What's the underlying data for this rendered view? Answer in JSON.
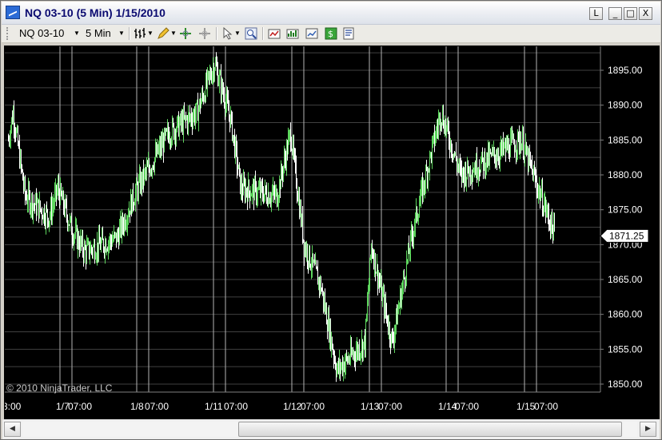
{
  "window": {
    "title": "NQ 03-10 (5 Min)  1/15/2010",
    "buttons": [
      "L",
      "_",
      "□",
      "X"
    ]
  },
  "toolbar": {
    "instrument": "NQ 03-10",
    "interval": "5 Min",
    "icons": [
      "bar-type-icon",
      "drawing-tool-icon",
      "crosshair-icon",
      "global-crosshair-icon",
      "pointer-icon",
      "zoom-icon",
      "data-series-icon",
      "indicators-icon",
      "strategies-icon",
      "money-icon",
      "properties-icon"
    ]
  },
  "chart": {
    "copyright": "© 2010 NinjaTrader, LLC",
    "price_scale": [
      "1895.00",
      "1890.00",
      "1885.00",
      "1880.00",
      "1875.00",
      "1870.00",
      "1865.00",
      "1860.00",
      "1855.00",
      "1850.00"
    ],
    "last_price": "1871.25",
    "time_labels": [
      "3:00",
      "1/7",
      "07:00",
      "1/8",
      "07:00",
      "1/11",
      "07:00",
      "1/12",
      "07:00",
      "1/13",
      "07:00",
      "1/14",
      "07:00",
      "1/15",
      "07:00"
    ],
    "colors": {
      "background": "#000000",
      "up": "#5ed65e",
      "down": "#ffffff",
      "grid": "#404040",
      "separator": "#b4b4b4"
    }
  },
  "chart_data": {
    "type": "line",
    "instrument": "NQ 03-10",
    "interval": "5 Min",
    "ylim": [
      1849,
      1899
    ],
    "x": [
      "1/6 close",
      "1/7 open",
      "1/7",
      "1/7",
      "1/7 close",
      "1/8 open",
      "1/8",
      "1/8",
      "1/8 close",
      "1/11 open",
      "1/11",
      "1/11",
      "1/11 close",
      "1/12 open",
      "1/12",
      "1/12",
      "1/12 close",
      "1/13 open",
      "1/13",
      "1/13",
      "1/13 close",
      "1/14 open",
      "1/14",
      "1/14",
      "1/14 close",
      "1/15 open",
      "1/15",
      "1/15 last"
    ],
    "values": [
      1885,
      1889,
      1877,
      1874,
      1878,
      1872,
      1869,
      1871,
      1878,
      1881,
      1886,
      1889,
      1896,
      1888,
      1878,
      1877,
      1886,
      1870,
      1864,
      1852,
      1856,
      1870,
      1856,
      1872,
      1889,
      1880,
      1885,
      1871.25
    ]
  }
}
